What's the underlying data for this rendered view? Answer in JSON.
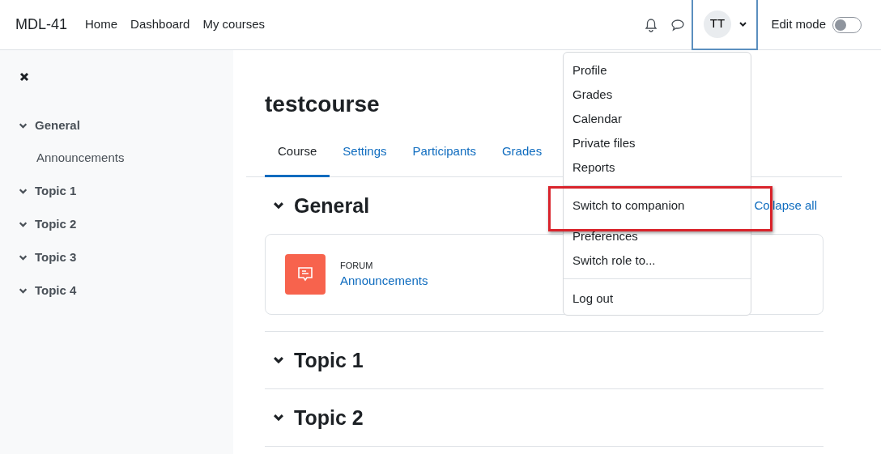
{
  "navbar": {
    "brand": "MDL-41",
    "links": [
      {
        "label": "Home"
      },
      {
        "label": "Dashboard"
      },
      {
        "label": "My courses"
      }
    ],
    "user_initials": "TT",
    "edit_mode": {
      "label": "Edit mode",
      "on": false
    }
  },
  "user_menu": {
    "open": true,
    "groups": [
      [
        {
          "label": "Profile",
          "highlighted": false
        },
        {
          "label": "Grades",
          "highlighted": false
        },
        {
          "label": "Calendar",
          "highlighted": false
        },
        {
          "label": "Private files",
          "highlighted": false
        },
        {
          "label": "Reports",
          "highlighted": false
        }
      ],
      [
        {
          "label": "Switch to companion",
          "highlighted": true
        },
        {
          "label": "Preferences",
          "highlighted": false
        },
        {
          "label": "Switch role to...",
          "highlighted": false
        }
      ],
      [
        {
          "label": "Log out",
          "highlighted": false
        }
      ]
    ]
  },
  "sidebar": {
    "items": [
      {
        "label": "General",
        "expanded": true,
        "children": [
          {
            "label": "Announcements"
          }
        ]
      },
      {
        "label": "Topic 1",
        "expanded": true
      },
      {
        "label": "Topic 2",
        "expanded": true
      },
      {
        "label": "Topic 3",
        "expanded": true
      },
      {
        "label": "Topic 4",
        "expanded": true
      }
    ]
  },
  "course": {
    "title": "testcourse",
    "tabs": [
      {
        "label": "Course",
        "selected": true
      },
      {
        "label": "Settings",
        "selected": false
      },
      {
        "label": "Participants",
        "selected": false
      },
      {
        "label": "Grades",
        "selected": false
      }
    ],
    "collapse_all": "Collapse all",
    "sections": [
      {
        "title": "General",
        "expanded": true,
        "activities": [
          {
            "type": "FORUM",
            "name": "Announcements"
          }
        ]
      },
      {
        "title": "Topic 1",
        "expanded": true
      },
      {
        "title": "Topic 2",
        "expanded": true
      }
    ]
  }
}
